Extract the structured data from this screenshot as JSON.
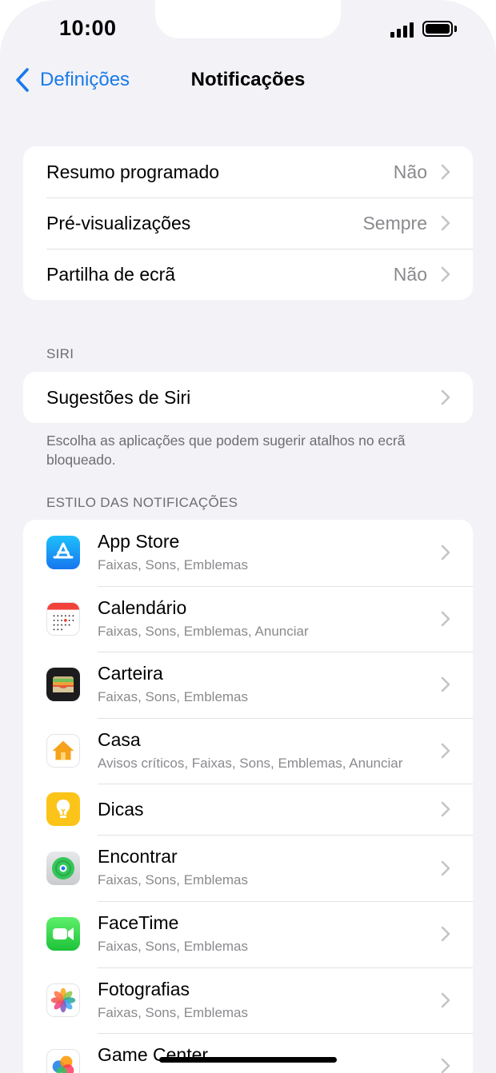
{
  "status": {
    "time": "10:00"
  },
  "nav": {
    "back_label": "Definições",
    "title": "Notificações"
  },
  "group1": [
    {
      "label": "Resumo programado",
      "value": "Não"
    },
    {
      "label": "Pré-visualizações",
      "value": "Sempre"
    },
    {
      "label": "Partilha de ecrã",
      "value": "Não"
    }
  ],
  "siri": {
    "header": "SIRI",
    "row_label": "Sugestões de Siri",
    "footer": "Escolha as aplicações que podem sugerir atalhos no ecrã bloqueado."
  },
  "styles_header": "ESTILO DAS NOTIFICAÇÕES",
  "apps": [
    {
      "name": "App Store",
      "sub": "Faixas, Sons, Emblemas",
      "icon": "app-store-icon"
    },
    {
      "name": "Calendário",
      "sub": "Faixas, Sons, Emblemas, Anunciar",
      "icon": "calendar-icon"
    },
    {
      "name": "Carteira",
      "sub": "Faixas, Sons, Emblemas",
      "icon": "wallet-icon"
    },
    {
      "name": "Casa",
      "sub": "Avisos críticos, Faixas, Sons, Emblemas, Anunciar",
      "icon": "home-icon"
    },
    {
      "name": "Dicas",
      "sub": "",
      "icon": "tips-icon"
    },
    {
      "name": "Encontrar",
      "sub": "Faixas, Sons, Emblemas",
      "icon": "find-my-icon"
    },
    {
      "name": "FaceTime",
      "sub": "Faixas, Sons, Emblemas",
      "icon": "facetime-icon"
    },
    {
      "name": "Fotografias",
      "sub": "Faixas, Sons, Emblemas",
      "icon": "photos-icon"
    },
    {
      "name": "Game Center",
      "sub": "",
      "icon": "game-center-icon"
    }
  ],
  "colors": {
    "accent": "#1a7ae8",
    "background": "#f2f2f7"
  }
}
